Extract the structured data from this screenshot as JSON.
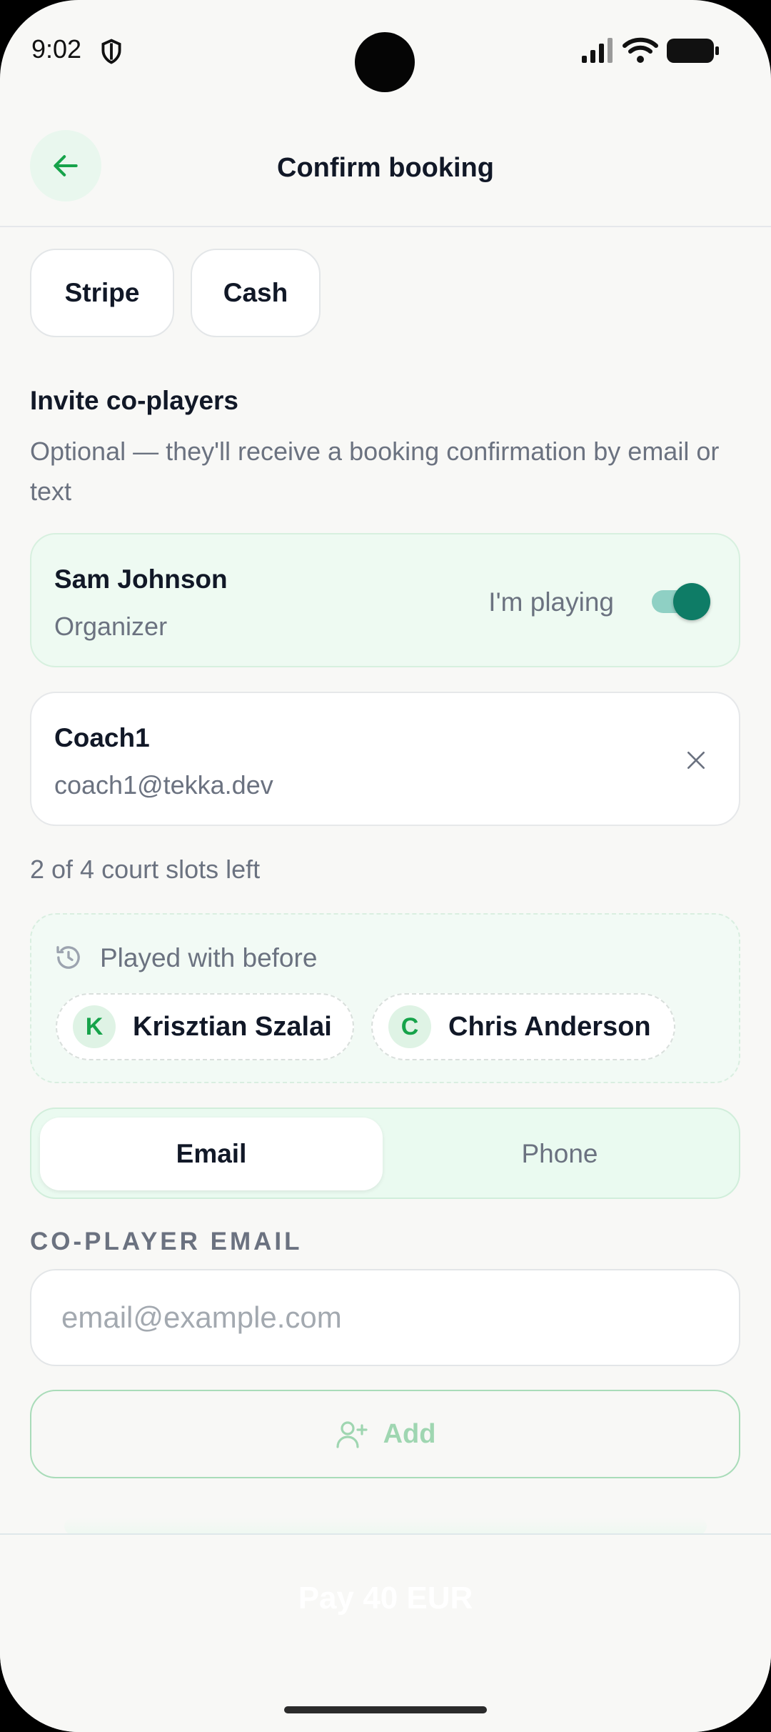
{
  "status_bar": {
    "time": "9:02"
  },
  "header": {
    "title": "Confirm booking"
  },
  "payment_methods": [
    {
      "label": "Stripe"
    },
    {
      "label": "Cash"
    }
  ],
  "invite": {
    "title": "Invite co-players",
    "subtitle": "Optional — they'll receive a booking confirmation by email or text"
  },
  "organizer": {
    "name": "Sam Johnson",
    "role": "Organizer",
    "playing_label": "I'm playing",
    "playing": true
  },
  "coplayers": [
    {
      "name": "Coach1",
      "email": "coach1@tekka.dev"
    }
  ],
  "slots_text": "2 of 4 court slots left",
  "played_before": {
    "title": "Played with before",
    "players": [
      {
        "initial": "K",
        "name": "Krisztian Szalai"
      },
      {
        "initial": "C",
        "name": "Chris Anderson"
      }
    ]
  },
  "contact_tabs": {
    "email": "Email",
    "phone": "Phone",
    "selected": "Email"
  },
  "email_field": {
    "label": "CO-PLAYER EMAIL",
    "placeholder": "email@example.com",
    "value": ""
  },
  "add_button": {
    "label": "Add"
  },
  "pay_button": {
    "label": "Pay 40 EUR"
  },
  "colors": {
    "accent": "#16a34a",
    "toggle": "#0e7c66",
    "background": "#f8f8f6"
  }
}
